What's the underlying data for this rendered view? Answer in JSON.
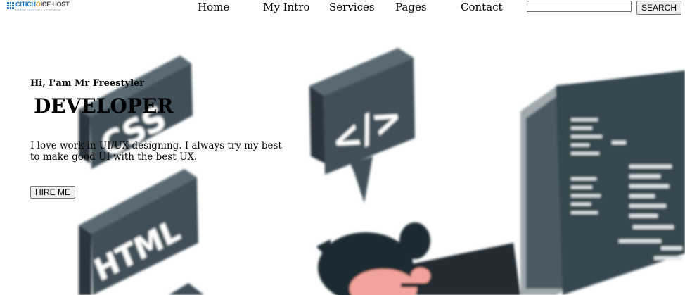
{
  "header": {
    "logo": {
      "text_part1": "CITICH",
      "text_part2": "O",
      "text_part3": "ICE HOST",
      "tagline": "DOMAIN | HOSTING | ECOMMERCE"
    },
    "nav": [
      {
        "label": "Home"
      },
      {
        "label": "My Intro"
      },
      {
        "label": "Services"
      },
      {
        "label": "Pages"
      },
      {
        "label": "Contact"
      }
    ],
    "search": {
      "value": "",
      "placeholder": "",
      "button_label": "SEARCH"
    }
  },
  "hero": {
    "greeting": "Hi, I'am Mr Freestyler",
    "role": "DEVELOPER",
    "description": "I love work in UI/UX designing. I always try my best to make good UI with the best UX.",
    "cta_label": "HIRE ME"
  },
  "illustration": {
    "tiles": [
      {
        "label": "CSS"
      },
      {
        "label": "HTML"
      },
      {
        "label": "</>"
      }
    ],
    "colors": {
      "tile_face": "#3f4f58",
      "tile_side": "#2a363d",
      "tile_text": "#ffffff",
      "monitor": "#354650",
      "hair": "#1f2a30",
      "skin": "#f3a49a"
    }
  }
}
